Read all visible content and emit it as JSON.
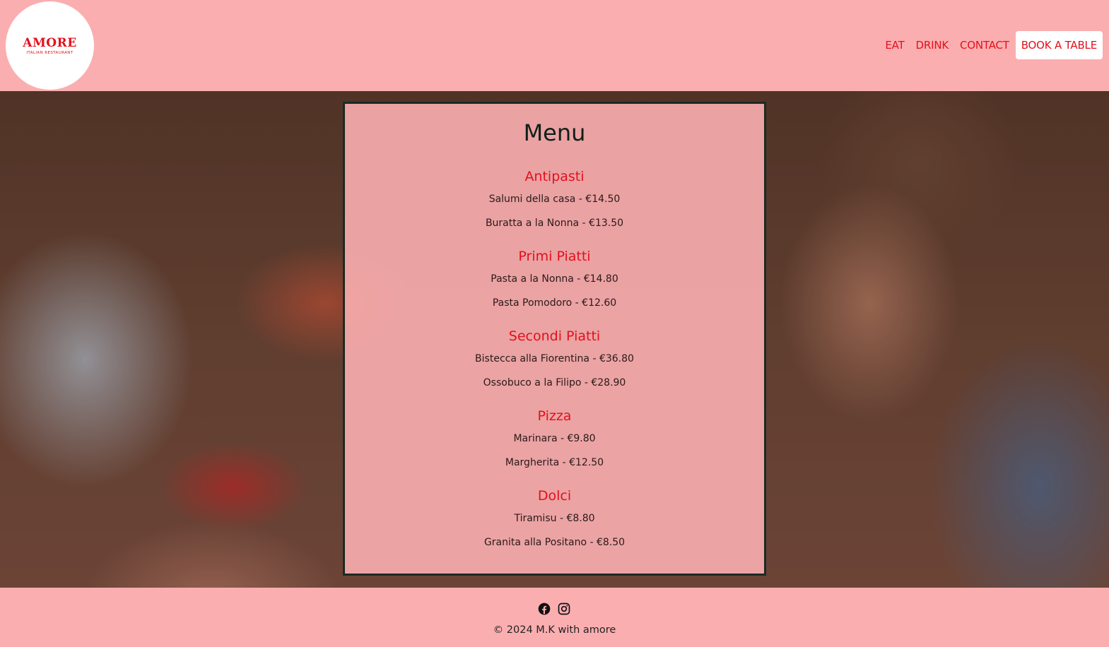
{
  "header": {
    "logo": {
      "name": "AMORE",
      "tagline": "ITALIAN RESTAURANT"
    },
    "nav": [
      {
        "label": "EAT"
      },
      {
        "label": "DRINK"
      },
      {
        "label": "CONTACT"
      }
    ],
    "cta_label": "BOOK A TABLE"
  },
  "menu": {
    "title": "Menu",
    "sections": [
      {
        "heading": "Antipasti",
        "items": [
          "Salumi della casa - €14.50",
          "Buratta a la Nonna - €13.50"
        ]
      },
      {
        "heading": "Primi Piatti",
        "items": [
          "Pasta a la Nonna - €14.80",
          "Pasta Pomodoro - €12.60"
        ]
      },
      {
        "heading": "Secondi Piatti",
        "items": [
          "Bistecca alla Fiorentina - €36.80",
          "Ossobuco a la Filipo - €28.90"
        ]
      },
      {
        "heading": "Pizza",
        "items": [
          "Marinara - €9.80",
          "Margherita - €12.50"
        ]
      },
      {
        "heading": "Dolci",
        "items": [
          "Tiramisu - €8.80",
          "Granita alla Positano - €8.50"
        ]
      }
    ]
  },
  "footer": {
    "socials": [
      {
        "icon": "facebook-icon"
      },
      {
        "icon": "instagram-icon"
      }
    ],
    "copyright": "© 2024 M.K with amore"
  },
  "colors": {
    "background": "#fbaeb0",
    "accent": "#e3101c",
    "card_border": "#1b2a24"
  }
}
